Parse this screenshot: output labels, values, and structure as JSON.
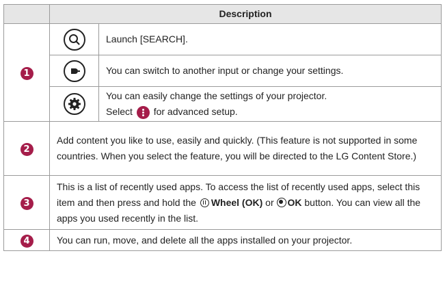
{
  "header": {
    "description": "Description"
  },
  "colors": {
    "badge": "#a51d4a",
    "header_bg": "#e6e6e6",
    "border": "#9a9a9a"
  },
  "rows": [
    {
      "number": "1",
      "items": [
        {
          "icon": "search-icon",
          "text": "Launch [SEARCH]."
        },
        {
          "icon": "input-icon",
          "text": "You can switch to another input or change your settings."
        },
        {
          "icon": "settings-gear-icon",
          "text_line1": "You can easily change the settings of your projector.",
          "text_line2_before": "Select",
          "text_line2_after": "for advanced setup.",
          "inline_icon": "more-options-icon"
        }
      ]
    },
    {
      "number": "2",
      "text": "Add content you like to use, easily and quickly. (This feature is not supported in some countries. When you select the feature, you will be directed to the LG Content Store.)"
    },
    {
      "number": "3",
      "text_part1": "This is a list of recently used apps. To access the list of recently used apps, select this item and then press and hold the",
      "wheel_label": "Wheel (OK)",
      "or_word": "or",
      "ok_label": "OK",
      "text_part2": "button. You can view all the apps you used recently in the list."
    },
    {
      "number": "4",
      "text": "You can run, move, and delete all the apps installed on your projector."
    }
  ]
}
